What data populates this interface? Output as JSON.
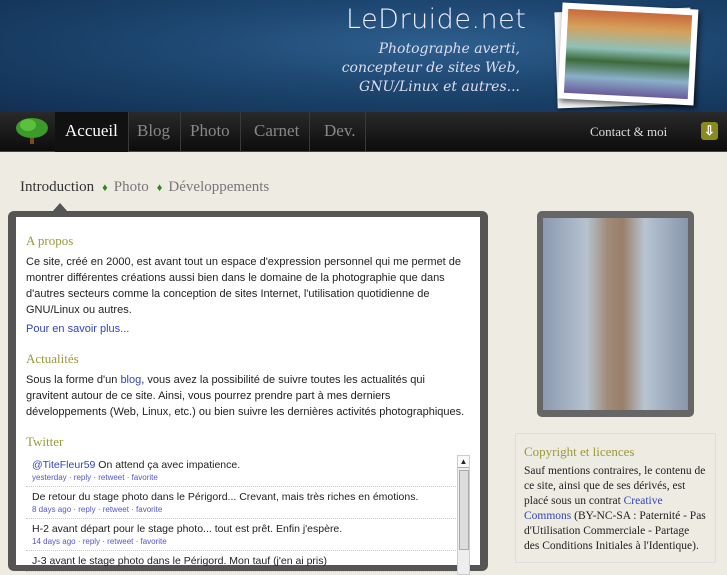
{
  "header": {
    "logo": "LeDruide.net",
    "tagline": [
      "Photographe averti,",
      "concepteur de sites Web,",
      "GNU/Linux et autres..."
    ]
  },
  "nav": {
    "items": [
      "Accueil",
      "Blog",
      "Photo",
      "Carnet",
      "Dev."
    ],
    "contact": "Contact & moi"
  },
  "subnav": {
    "items": [
      "Introduction",
      "Photo",
      "Développements"
    ],
    "separator": "♦"
  },
  "apropos": {
    "title": "A propos",
    "text": "Ce site, créé en 2000, est avant tout un espace d'expression personnel qui me permet de montrer différentes créations aussi bien dans le domaine de la photographie que dans d'autres secteurs comme la conception de sites Internet, l'utilisation quotidienne de GNU/Linux ou autres.",
    "more": "Pour en savoir plus..."
  },
  "actus": {
    "title": "Actualités",
    "before": "Sous la forme d'un ",
    "link": "blog",
    "after": ", vous avez la possibilité de suivre toutes les actualités qui gravitent autour de ce site. Ainsi, vous pourrez prendre part à mes derniers développements (Web, Linux, etc.) ou bien suivre les dernières activités photographiques."
  },
  "twitter": {
    "title": "Twitter",
    "tweets": [
      {
        "mention": "@TiteFleur59",
        "text": " On attend ça avec impatience.",
        "meta": "yesterday · reply · retweet · favorite"
      },
      {
        "mention": "",
        "text": "De retour du stage photo dans le Périgord... Crevant, mais très riches en émotions.",
        "meta": "8 days ago · reply · retweet · favorite"
      },
      {
        "mention": "",
        "text": "H-2 avant départ pour le stage photo... tout est prêt. Enfin j'espère.",
        "meta": "14 days ago · reply · retweet · favorite"
      },
      {
        "mention": "",
        "text": "J-3 avant le stage photo dans le Périgord. Mon tauf (j'en ai pris)",
        "meta": ""
      }
    ]
  },
  "copyright": {
    "title": "Copyright et licences",
    "before": "Sauf mentions contraires, le contenu de ce site, ainsi que de ses dérivés, est placé sous un contrat ",
    "link": "Creative Commons",
    "after": " (BY-NC-SA : Paternité - Pas d'Utilisation Commerciale - Partage des Conditions Initiales à l'Identique)."
  }
}
